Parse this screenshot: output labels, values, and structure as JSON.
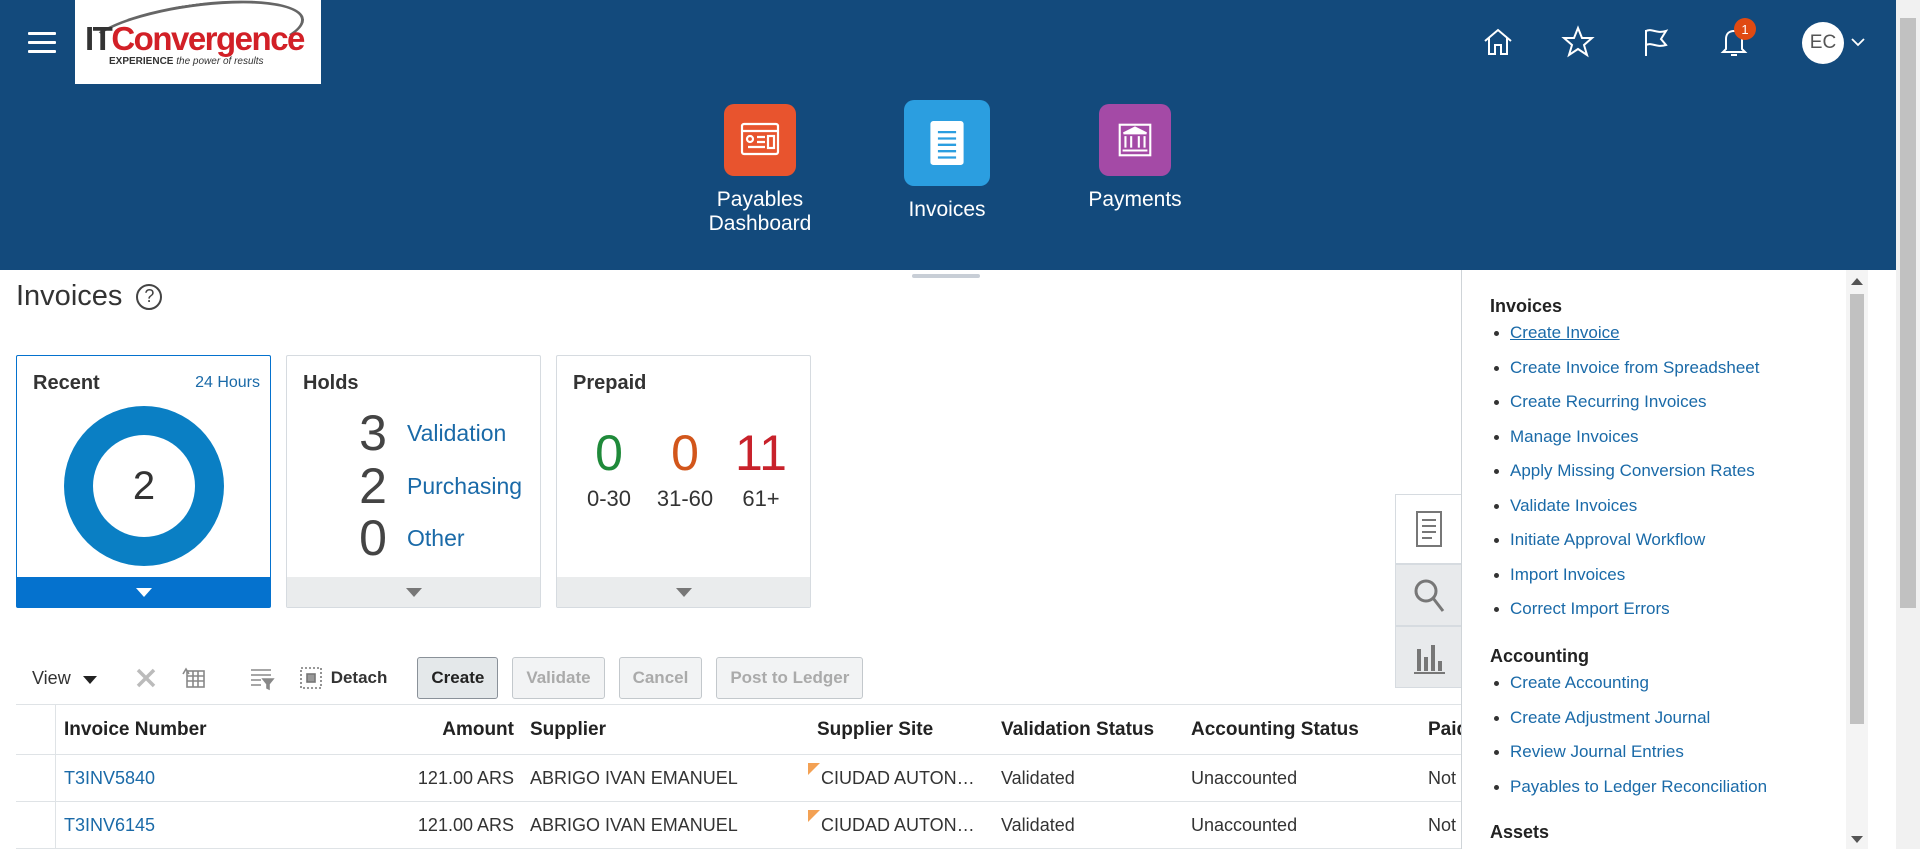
{
  "header": {
    "logo": {
      "brand_it": "IT",
      "brand_rest": "Convergence",
      "tagline_strong": "EXPERIENCE",
      "tagline": "the power of results"
    },
    "icons": [
      "hamburger-icon",
      "home-icon",
      "star-icon",
      "flag-icon",
      "bell-icon",
      "avatar"
    ],
    "notification_count": "1",
    "user_initials": "EC",
    "apps": [
      {
        "label_line1": "Payables",
        "label_line2": "Dashboard",
        "color": "#e8542e"
      },
      {
        "label_line1": "Invoices",
        "label_line2": "",
        "color": "#2b9ee0"
      },
      {
        "label_line1": "Payments",
        "label_line2": "",
        "color": "#a44aa6"
      }
    ]
  },
  "page": {
    "title": "Invoices",
    "help": "?"
  },
  "tiles": {
    "recent": {
      "title": "Recent",
      "subtitle": "24 Hours",
      "count": "2",
      "color": "#0a7fc4"
    },
    "holds": {
      "title": "Holds",
      "rows": [
        {
          "count": "3",
          "label": "Validation"
        },
        {
          "count": "2",
          "label": "Purchasing"
        },
        {
          "count": "0",
          "label": "Other"
        }
      ]
    },
    "prepaid": {
      "title": "Prepaid",
      "cols": [
        {
          "count": "0",
          "range": "0-30",
          "color": "#1f8a3a"
        },
        {
          "count": "0",
          "range": "31-60",
          "color": "#d2561b"
        },
        {
          "count": "11",
          "range": "61+",
          "color": "#c8222b"
        }
      ]
    }
  },
  "toolbar": {
    "view_label": "View",
    "detach_label": "Detach",
    "create_label": "Create",
    "validate_label": "Validate",
    "cancel_label": "Cancel",
    "post_label": "Post to Ledger"
  },
  "table": {
    "columns": [
      "Invoice Number",
      "Amount",
      "Supplier",
      "Supplier Site",
      "Validation Status",
      "Accounting Status",
      "Paid"
    ],
    "rows": [
      {
        "invoice": "T3INV5840",
        "amount": "121.00 ARS",
        "supplier": "ABRIGO IVAN EMANUEL",
        "site": "CIUDAD AUTON…",
        "validation": "Validated",
        "accounting": "Unaccounted",
        "paid": "Not p"
      },
      {
        "invoice": "T3INV6145",
        "amount": "121.00 ARS",
        "supplier": "ABRIGO IVAN EMANUEL",
        "site": "CIUDAD AUTON…",
        "validation": "Validated",
        "accounting": "Unaccounted",
        "paid": "Not p"
      }
    ]
  },
  "panel": {
    "sections": [
      {
        "title": "Invoices",
        "items": [
          "Create Invoice",
          "Create Invoice from Spreadsheet",
          "Create Recurring Invoices",
          "Manage Invoices",
          "Apply Missing Conversion Rates",
          "Validate Invoices",
          "Initiate Approval Workflow",
          "Import Invoices",
          "Correct Import Errors"
        ]
      },
      {
        "title": "Accounting",
        "items": [
          "Create Accounting",
          "Create Adjustment Journal",
          "Review Journal Entries",
          "Payables to Ledger Reconciliation"
        ]
      },
      {
        "title": "Assets",
        "items": []
      }
    ],
    "tabs": [
      "tasks-icon",
      "search-icon",
      "reports-icon"
    ]
  }
}
